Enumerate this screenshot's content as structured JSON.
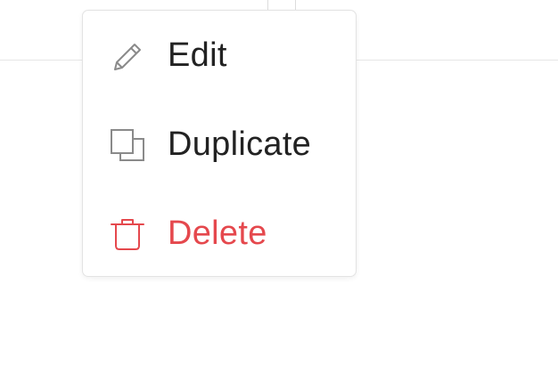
{
  "menu": {
    "items": [
      {
        "label": "Edit",
        "icon": "pencil-icon",
        "color": "#222222"
      },
      {
        "label": "Duplicate",
        "icon": "duplicate-icon",
        "color": "#222222"
      },
      {
        "label": "Delete",
        "icon": "trash-icon",
        "color": "#e5484d"
      }
    ]
  },
  "colors": {
    "text": "#222222",
    "icon": "#8a8a8a",
    "danger": "#e5484d",
    "border": "#e3e3e3"
  }
}
